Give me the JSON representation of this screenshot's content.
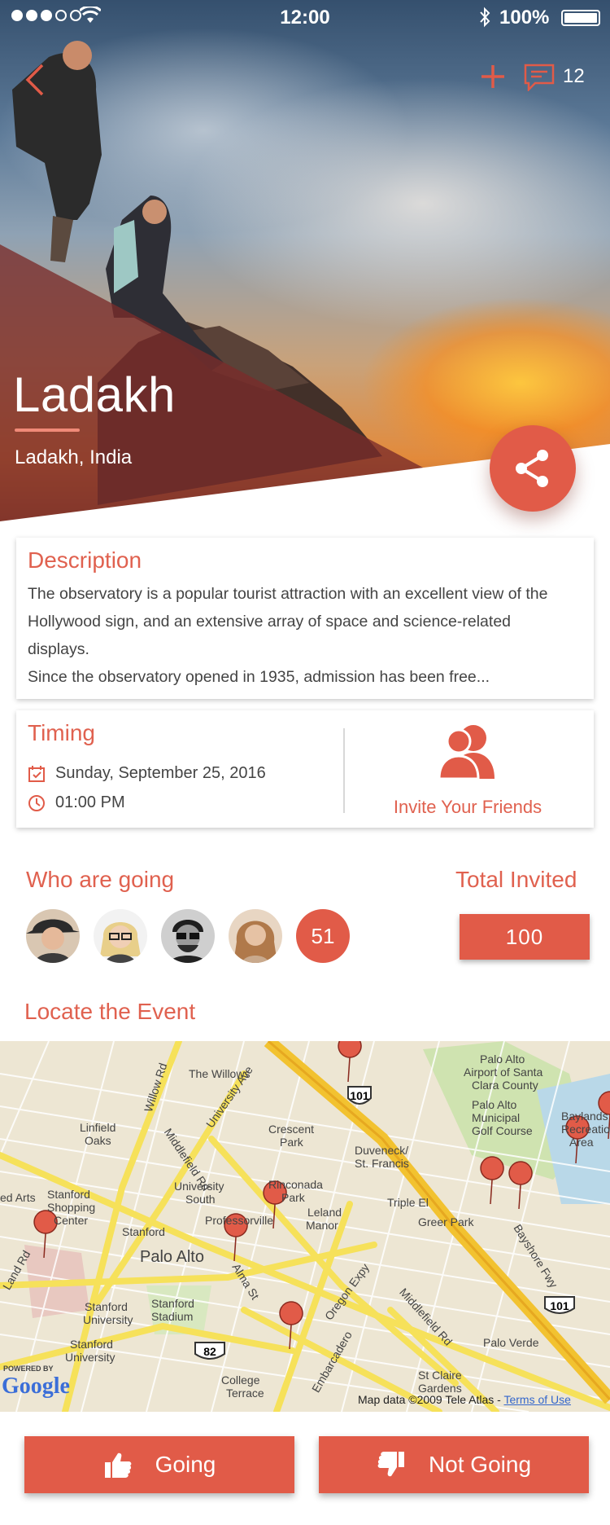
{
  "status_bar": {
    "time": "12:00",
    "battery": "100%"
  },
  "header": {
    "comment_count": "12"
  },
  "hero": {
    "title": "Ladakh",
    "subtitle": "Ladakh, India"
  },
  "description": {
    "title": "Description",
    "lines": [
      "The observatory is a popular tourist attraction with an excellent view of the",
      "Hollywood sign, and an extensive array of space and science-related",
      "displays.",
      "Since the observatory opened in 1935, admission has been free..."
    ]
  },
  "timing": {
    "title": "Timing",
    "date": "Sunday, September 25, 2016",
    "time": "01:00 PM",
    "invite_label": "Invite Your Friends"
  },
  "going": {
    "title": "Who are going",
    "count": "51",
    "total_title": "Total Invited",
    "total_value": "100"
  },
  "locate": {
    "title": "Locate the Event",
    "map_labels": [
      "Palo Alto",
      "Airport of Santa",
      "Clara County",
      "The Willows",
      "Palo Alto",
      "Municipal",
      "Golf Course",
      "Linfield",
      "Oaks",
      "Crescent",
      "Park",
      "Duveneck/",
      "St. Francis",
      "Baylands",
      "Recreation",
      "Area",
      "Stanford",
      "Shopping",
      "Center",
      "University",
      "South",
      "Rinconada",
      "Park",
      "Leland",
      "Manor",
      "Triple El",
      "Greer Park",
      "Stanford",
      "Palo Alto",
      "Professorville",
      "Stanford",
      "University",
      "Stanford",
      "Stadium",
      "Stanford",
      "University",
      "Palo Verde",
      "College",
      "Terrace",
      "St Claire",
      "Gardens",
      "University Ave",
      "Middlefield Rd",
      "Willow Rd",
      "Bayshore Fwy",
      "Oregon Expy",
      "Middlefield Rd",
      "Alma St",
      "Embarcadero",
      "ed Arts",
      "Land Rd"
    ],
    "highway_shields": [
      "101",
      "82",
      "101"
    ],
    "map_credit": "Map data ©2009 Tele Atlas - ",
    "terms": "Terms of Use",
    "powered_by": "POWERED BY",
    "google": "Google"
  },
  "actions": {
    "going": "Going",
    "not_going": "Not Going"
  },
  "colors": {
    "accent": "#e15b48",
    "accent_text": "#e0614f"
  }
}
